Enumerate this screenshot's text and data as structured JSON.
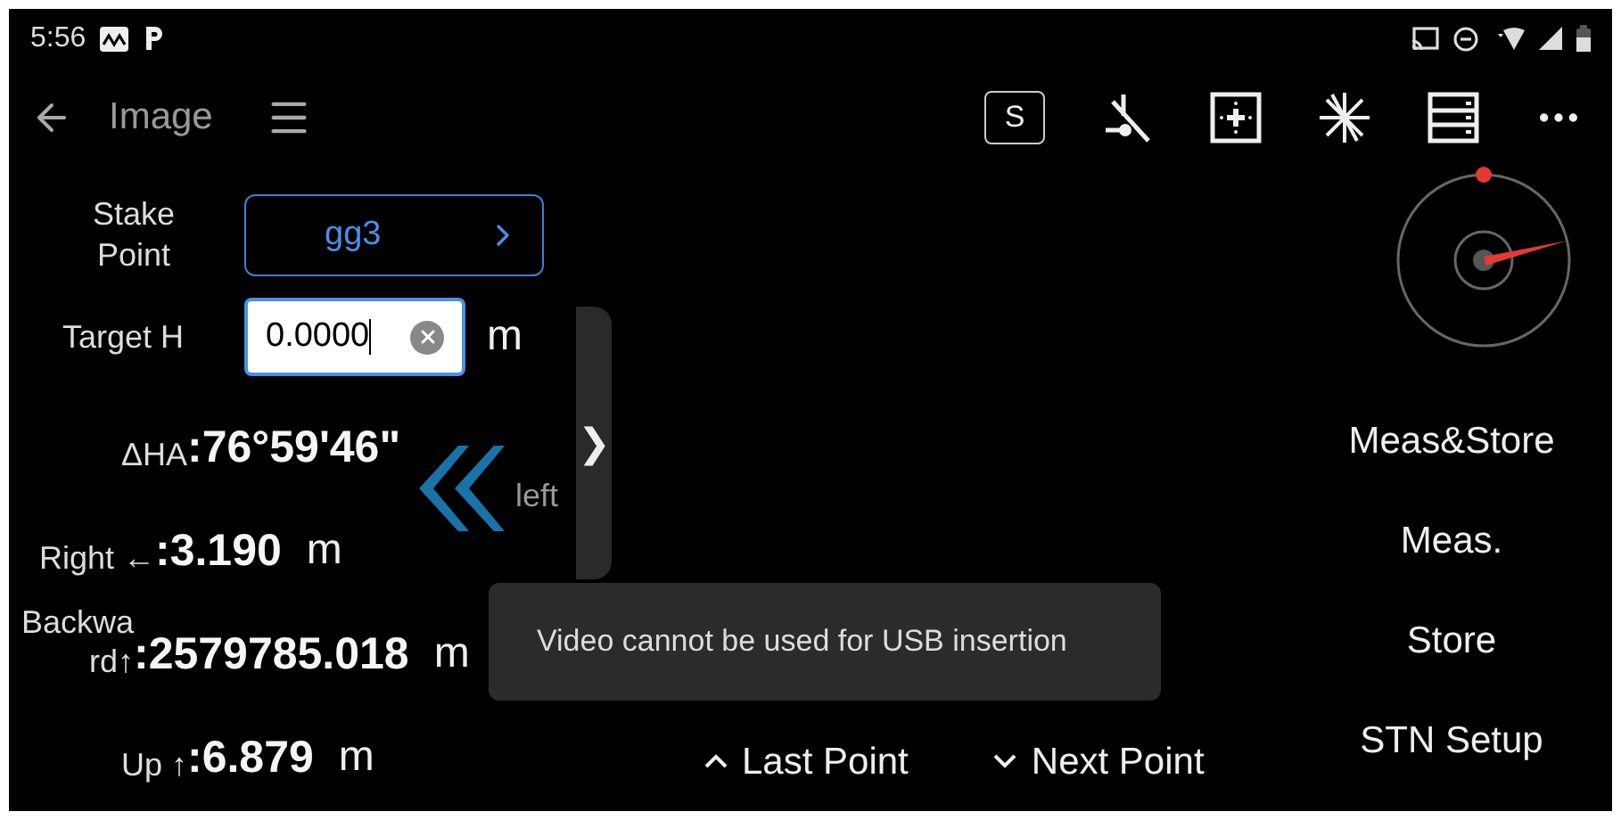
{
  "status_bar": {
    "time": "5:56"
  },
  "toolbar": {
    "title": "Image",
    "s_button": "S"
  },
  "stake_point": {
    "label": "Stake Point",
    "value": "gg3"
  },
  "target_h": {
    "label": "Target H",
    "value": "0.0000",
    "unit": "m"
  },
  "readings": [
    {
      "label": "ΔHA",
      "value": ":76°59'46\""
    },
    {
      "label": "Right ←",
      "value": ":3.190",
      "unit": "m"
    },
    {
      "label": "Backward↑",
      "value": ":2579785.018",
      "unit": "m"
    },
    {
      "label": "Up ↑",
      "value": ":6.879",
      "unit": "m"
    }
  ],
  "direction": {
    "text": "left"
  },
  "drawer_handle": "❯",
  "toast": "Video cannot be used for USB insertion",
  "nav": [
    {
      "label": "Last Point",
      "kind": "up"
    },
    {
      "label": "Next Point",
      "kind": "down"
    }
  ],
  "actions": [
    "Meas&Store",
    "Meas.",
    "Store",
    "STN Setup"
  ]
}
